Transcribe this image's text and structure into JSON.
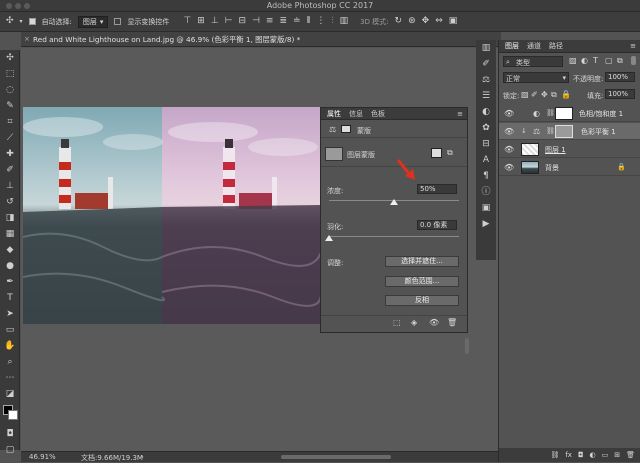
{
  "app": {
    "title": "Adobe Photoshop CC 2017"
  },
  "options_bar": {
    "auto_select_label": "自动选择:",
    "auto_select_value": "图层",
    "transform_label": "显示变换控件",
    "mode_3d": "3D 模式:"
  },
  "document": {
    "tab_title": "Red and White Lighthouse on Land.jpg @ 46.9% (色彩平衡 1, 图层蒙版/8) *"
  },
  "status": {
    "zoom": "46.91%",
    "doc_size": "文档:9.66M/19.3M"
  },
  "properties": {
    "tabs": [
      "属性",
      "信息",
      "色板"
    ],
    "mask_label": "蒙版",
    "layer_mask_label": "图层蒙版",
    "density_label": "浓度:",
    "density_value": "50%",
    "density_fraction": 0.5,
    "feather_label": "羽化:",
    "feather_value": "0.0 像素",
    "feather_fraction": 0.0,
    "adjust_label": "调整:",
    "btn_select_mask": "选择并遮住...",
    "btn_color_range": "颜色范围...",
    "btn_invert": "反相"
  },
  "layers": {
    "tabs": [
      "图层",
      "通道",
      "路径"
    ],
    "filter_kind": "类型",
    "blend_mode": "正常",
    "opacity_label": "不透明度:",
    "opacity_value": "100%",
    "lock_label": "锁定:",
    "fill_label": "填充:",
    "fill_value": "100%",
    "items": [
      {
        "name": "色相/饱和度 1"
      },
      {
        "name": "色彩平衡 1"
      },
      {
        "name": "图层 1"
      },
      {
        "name": "背景"
      }
    ]
  },
  "colors": {
    "accent_arrow": "#e0301e",
    "selected_row": "#6a6a6a"
  }
}
